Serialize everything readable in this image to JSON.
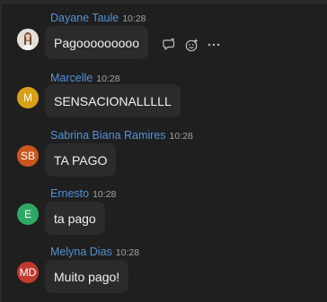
{
  "messages": [
    {
      "author": "Dayane Taule",
      "time": "10:28",
      "text": "Pagooooooooo",
      "avatar": {
        "kind": "photo",
        "icon": "user-photo"
      }
    },
    {
      "author": "Marcelle",
      "time": "10:28",
      "text": "SENSACIONALLLLL",
      "avatar": {
        "kind": "initials",
        "initials": "M",
        "color": "#d9a018"
      }
    },
    {
      "author": "Sabrina Biana Ramires",
      "time": "10:28",
      "text": "TA PAGO",
      "avatar": {
        "kind": "initials",
        "initials": "SB",
        "color": "#c9571e"
      }
    },
    {
      "author": "Ernesto",
      "time": "10:28",
      "text": "ta pago",
      "avatar": {
        "kind": "initials",
        "initials": "E",
        "color": "#2fa866"
      }
    },
    {
      "author": "Melyna Dias",
      "time": "10:28",
      "text": "Muito pago!",
      "avatar": {
        "kind": "initials",
        "initials": "MD",
        "color": "#c2392d"
      }
    }
  ],
  "hover_actions": {
    "reply_icon": "reply-in-thread-icon",
    "reaction_icon": "add-reaction-icon",
    "more_icon": "more-options-icon"
  },
  "colors": {
    "background": "#1f1f1f",
    "bubble": "#2b2b2b",
    "author": "#4f93d8",
    "time": "#a3a3a3"
  }
}
